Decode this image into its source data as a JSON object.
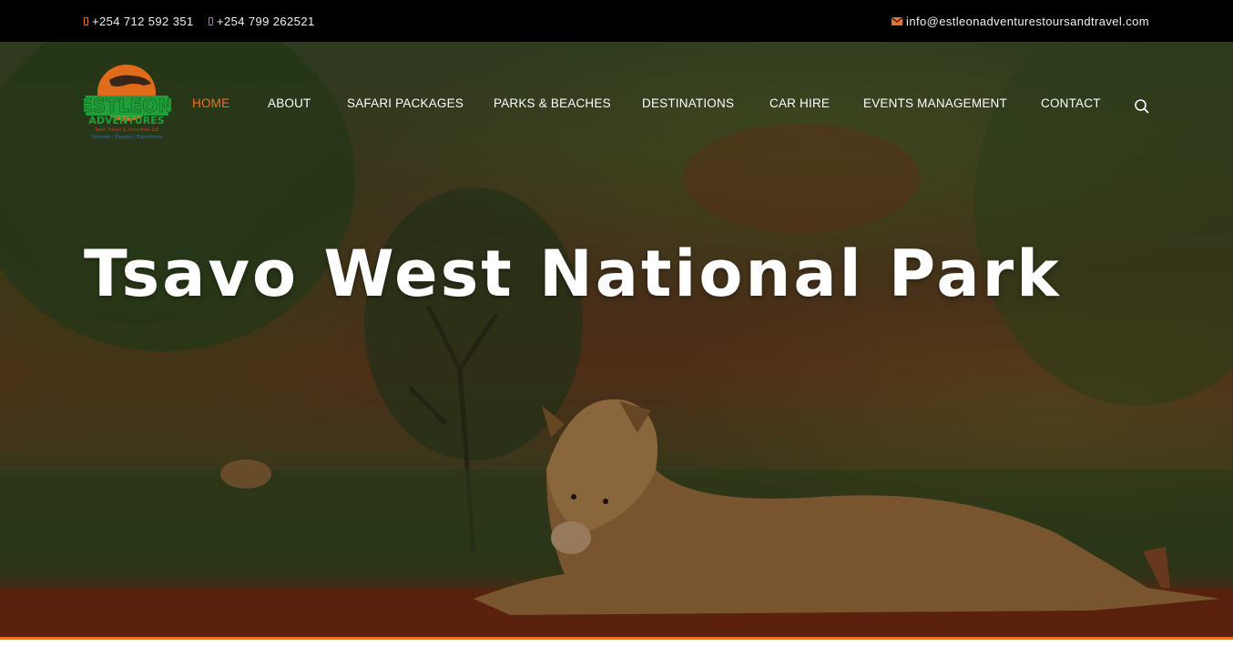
{
  "topbar": {
    "phone1": "+254 712 592 351",
    "phone2": "+254 799 262521",
    "email": "info@estleonadventurestoursandtravel.com"
  },
  "logo": {
    "line1": "ESTLEON",
    "line2": "ADVENTURES",
    "line3": "Tours Travel & Securities Ltd",
    "line4": "Discover | Explore | Experience"
  },
  "nav": {
    "items": [
      {
        "label": "HOME",
        "active": true
      },
      {
        "label": "ABOUT"
      },
      {
        "label": "SAFARI PACKAGES"
      },
      {
        "label": "PARKS & BEACHES"
      },
      {
        "label": "DESTINATIONS"
      },
      {
        "label": "CAR HIRE"
      },
      {
        "label": "EVENTS MANAGEMENT"
      },
      {
        "label": "CONTACT"
      }
    ],
    "search_icon": "search-icon"
  },
  "hero": {
    "title": "Tsavo West National Park"
  },
  "colors": {
    "accent": "#e8732a",
    "topbar_bg": "#000000",
    "text": "#ffffff",
    "logo_green": "#1f9e3a",
    "logo_orange": "#e06b1b"
  }
}
